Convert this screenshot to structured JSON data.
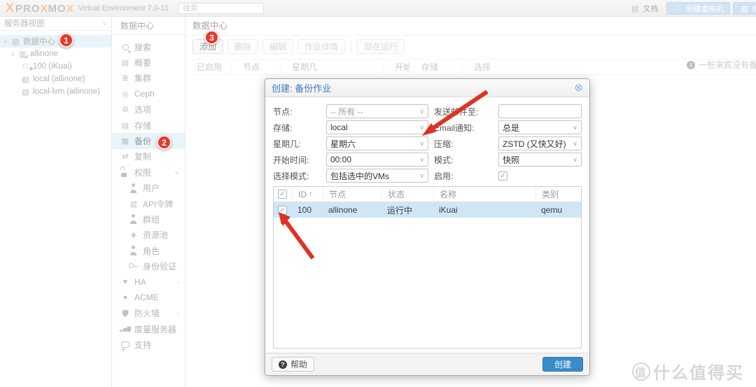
{
  "topbar": {
    "logo": {
      "mark": "X",
      "p1": "PRO",
      "x1": "X",
      "p2": "MO",
      "x2": "X"
    },
    "subtitle": "Virtual Environment 7.0-11",
    "search_placeholder": "搜索",
    "docs_label": "文档",
    "create_vm_label": "创建虚拟机",
    "create_ct_label": "创建CT"
  },
  "tree": {
    "header": "服务器视图",
    "items": [
      {
        "label": "数据中心",
        "icon": "datacenter-icon"
      },
      {
        "label": "allinone",
        "icon": "server-icon"
      },
      {
        "label": "100 (iKuai)",
        "icon": "vm-icon"
      },
      {
        "label": "local (allinone)",
        "icon": "storage-icon"
      },
      {
        "label": "local-lvm (allinone)",
        "icon": "storage-icon"
      }
    ]
  },
  "menu": {
    "header": "数据中心",
    "items": [
      {
        "label": "搜索",
        "icon": "search-icon"
      },
      {
        "label": "概要",
        "icon": "book-icon"
      },
      {
        "label": "集群",
        "icon": "cluster-icon"
      },
      {
        "label": "Ceph",
        "icon": "ceph-icon"
      },
      {
        "label": "选项",
        "icon": "gear-icon"
      },
      {
        "label": "存储",
        "icon": "database-icon"
      },
      {
        "label": "备份",
        "icon": "backup-icon"
      },
      {
        "label": "复制",
        "icon": "replication-icon"
      },
      {
        "label": "权限",
        "icon": "unlock-icon",
        "chevron": "chevron-down-icon"
      },
      {
        "label": "用户",
        "icon": "user-icon"
      },
      {
        "label": "API令牌",
        "icon": "token-icon"
      },
      {
        "label": "群组",
        "icon": "group-icon"
      },
      {
        "label": "资源池",
        "icon": "pool-icon"
      },
      {
        "label": "角色",
        "icon": "role-icon"
      },
      {
        "label": "身份验证",
        "icon": "key-icon"
      },
      {
        "label": "HA",
        "icon": "heart-icon",
        "chevron": "chevron-right-icon"
      },
      {
        "label": "ACME",
        "icon": "dot-icon"
      },
      {
        "label": "防火墙",
        "icon": "shield-icon",
        "chevron": "chevron-right-icon"
      },
      {
        "label": "度量服务器",
        "icon": "chart-icon"
      },
      {
        "label": "支持",
        "icon": "chat-icon"
      }
    ]
  },
  "content": {
    "title": "数据中心",
    "toolbar": [
      {
        "label": "添加"
      },
      {
        "label": "删除"
      },
      {
        "label": "编辑"
      },
      {
        "label": "作业详情"
      },
      {
        "label": "现在运行"
      }
    ],
    "notice": "一些来宾没有备份",
    "table_headers": [
      "已启用",
      "节点",
      "星期几",
      "开始...",
      "存储",
      "选择"
    ]
  },
  "dialog": {
    "title": "创建: 备份作业",
    "fields_left": [
      {
        "label": "节点:",
        "value": "-- 所有 --"
      },
      {
        "label": "存储:",
        "value": "local"
      },
      {
        "label": "星期几:",
        "value": "星期六"
      },
      {
        "label": "开始时间:",
        "value": "00:00"
      },
      {
        "label": "选择模式:",
        "value": "包括选中的VMs"
      }
    ],
    "fields_right": [
      {
        "label": "发送邮件至:",
        "value": ""
      },
      {
        "label": "Email通知:",
        "value": "总是"
      },
      {
        "label": "压缩:",
        "value": "ZSTD (又快又好)"
      },
      {
        "label": "模式:",
        "value": "快照"
      },
      {
        "label": "启用:",
        "value": ""
      }
    ],
    "table": {
      "headers": [
        "ID",
        "节点",
        "状态",
        "名称",
        "类别"
      ],
      "sort_icon": "↑",
      "rows": [
        [
          "100",
          "allinone",
          "运行中",
          "iKuai",
          "qemu"
        ]
      ]
    },
    "help_label": "帮助",
    "create_label": "创建"
  },
  "annotations": {
    "badges": [
      "1",
      "2",
      "3"
    ]
  },
  "watermark": {
    "badge": "值",
    "text": "什么值得买"
  },
  "colors": {
    "accent_blue": "#3a8bc9",
    "selection_blue": "#d9eaf7",
    "row_selection": "#cfe6f7",
    "annotation_red": "#e43a2c",
    "proxmox_orange": "#efa24a",
    "title_blue": "#3b7cb8"
  }
}
